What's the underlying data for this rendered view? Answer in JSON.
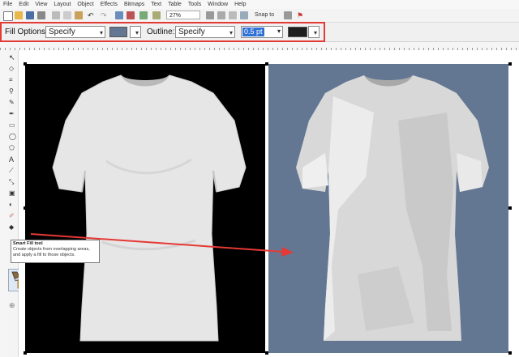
{
  "menu": [
    "File",
    "Edit",
    "View",
    "Layout",
    "Object",
    "Effects",
    "Bitmaps",
    "Text",
    "Table",
    "Tools",
    "Window",
    "Help"
  ],
  "toolbar": {
    "zoom": "27%",
    "snap_label": "Snap to"
  },
  "property_bar": {
    "fill_label": "Fill Options:",
    "fill_mode": "Specify",
    "fill_color": "#637792",
    "outline_label": "Outline:",
    "outline_mode": "Specify",
    "outline_width": "0.5 pt",
    "outline_color": "#1e1e1e"
  },
  "tooltip": {
    "title": "Smart Fill tool",
    "body": "Create objects from overlapping areas, and apply a fill to those objects."
  },
  "colors": {
    "highlight": "#e53935",
    "canvas_left": "#000000",
    "canvas_right": "#637792"
  }
}
